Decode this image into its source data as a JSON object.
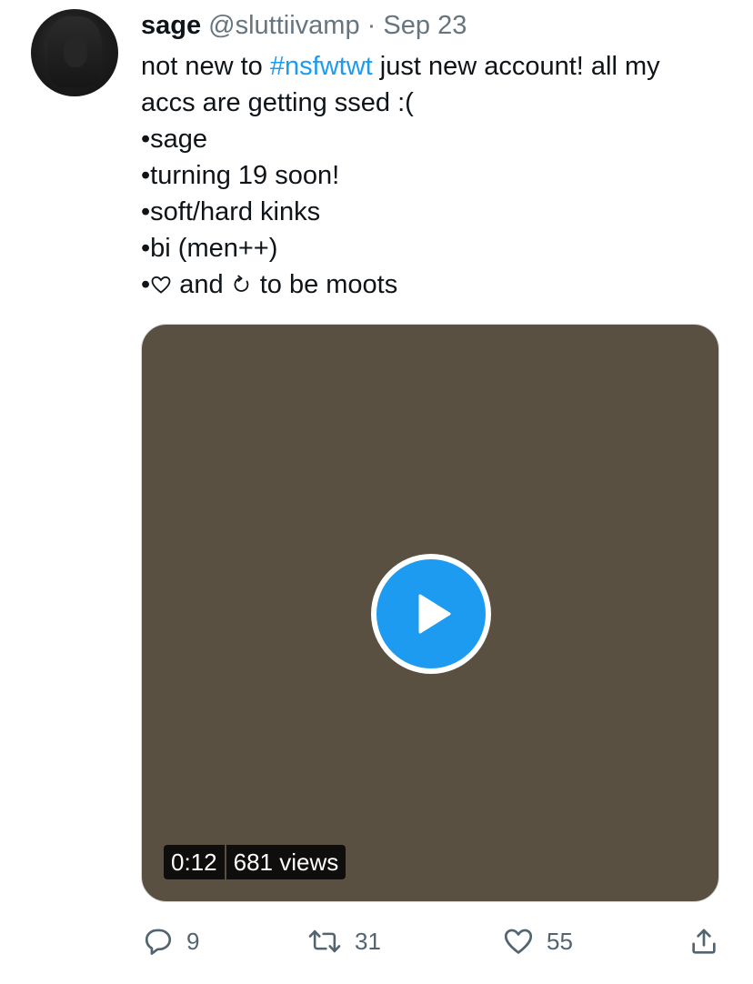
{
  "tweet": {
    "author_name": "sage",
    "author_handle": "@sluttiivamp",
    "separator": "·",
    "date": "Sep 23",
    "text_before_hashtag": "not new to ",
    "hashtag": "#nsfwtwt",
    "text_after_hashtag": " just new account! all my",
    "line2": "accs are getting ssed :(",
    "bullets": [
      "•sage",
      "•turning 19 soon!",
      "•soft/hard kinks",
      "•bi (men++)"
    ],
    "last_line_bullet": "•",
    "last_line_and": " and ",
    "last_line_end": " to be moots",
    "heart_icon": "heart-outline-icon",
    "refresh_icon": "clockwise-refresh-icon"
  },
  "video": {
    "duration": "0:12",
    "views": "681 views",
    "background_color": "#595042",
    "play_color": "#1d9bf0"
  },
  "actions": {
    "reply_count": "9",
    "retweet_count": "31",
    "like_count": "55",
    "share_icon": "share-icon"
  }
}
